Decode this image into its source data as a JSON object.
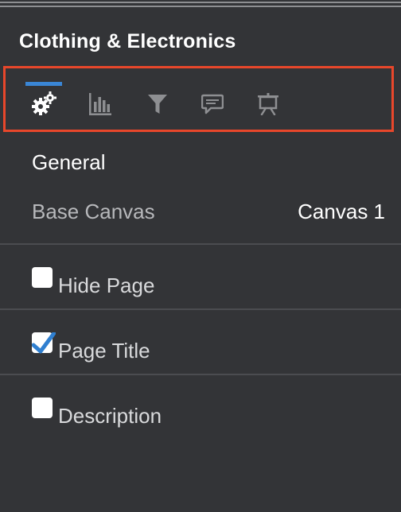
{
  "panel": {
    "title": "Clothing & Electronics"
  },
  "toolbar": {
    "highlight_color": "#e8472b",
    "active_indicator_color": "#3a86d6",
    "tabs": [
      {
        "icon": "gears-icon",
        "active": true
      },
      {
        "icon": "bar-chart-icon",
        "active": false
      },
      {
        "icon": "filter-icon",
        "active": false
      },
      {
        "icon": "comment-icon",
        "active": false
      },
      {
        "icon": "presentation-icon",
        "active": false
      }
    ]
  },
  "general": {
    "heading": "General",
    "base_canvas": {
      "label": "Base Canvas",
      "value": "Canvas 1"
    }
  },
  "options": [
    {
      "label": "Hide Page",
      "checked": false
    },
    {
      "label": "Page Title",
      "checked": true
    },
    {
      "label": "Description",
      "checked": false
    }
  ]
}
